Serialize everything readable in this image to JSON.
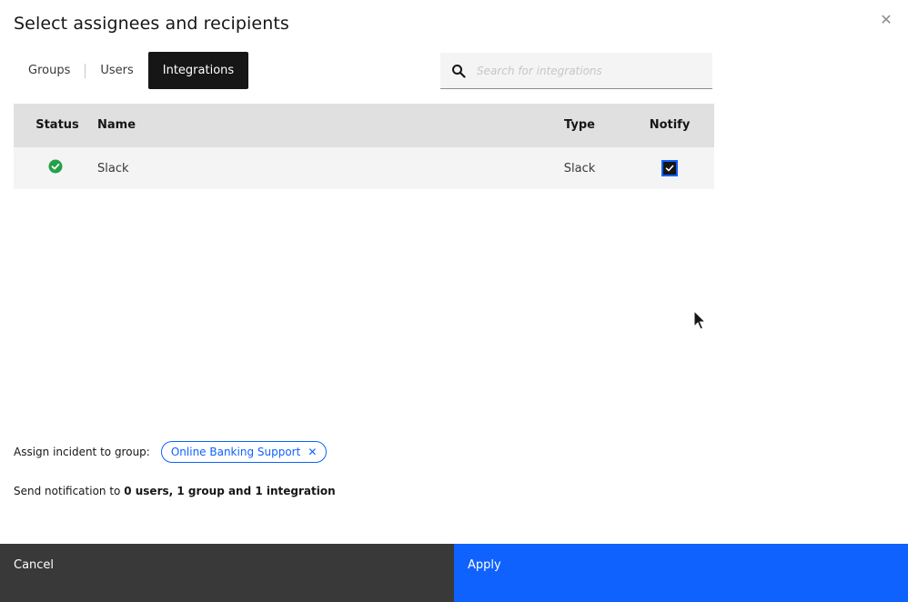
{
  "modal": {
    "title": "Select assignees and recipients",
    "close_icon": "close-icon"
  },
  "tabs": [
    {
      "label": "Groups",
      "active": false
    },
    {
      "label": "Users",
      "active": false
    },
    {
      "label": "Integrations",
      "active": true
    }
  ],
  "search": {
    "placeholder": "Search for integrations",
    "value": "",
    "icon": "search-icon"
  },
  "table": {
    "headers": {
      "status": "Status",
      "name": "Name",
      "type": "Type",
      "notify": "Notify"
    },
    "rows": [
      {
        "status": "ok",
        "name": "Slack",
        "type": "Slack",
        "notify": true
      }
    ]
  },
  "assign": {
    "label": "Assign incident to group:",
    "group_tag": "Online Banking Support"
  },
  "summary": {
    "prefix": "Send notification to",
    "detail": "0 users, 1 group and 1 integration"
  },
  "footer": {
    "cancel_label": "Cancel",
    "apply_label": "Apply"
  },
  "colors": {
    "primary": "#0f62fe",
    "status_ok": "#24a148",
    "dark": "#161616",
    "footer_secondary": "#393939"
  }
}
